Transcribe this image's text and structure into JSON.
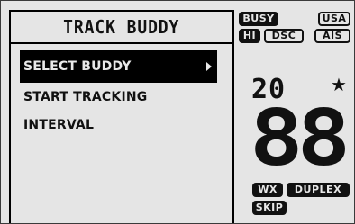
{
  "menu": {
    "title": "TRACK BUDDY",
    "items": [
      {
        "label": "SELECT BUDDY",
        "selected": true,
        "has_submenu": true
      },
      {
        "label": "START TRACKING",
        "selected": false,
        "has_submenu": false
      },
      {
        "label": "INTERVAL",
        "selected": false,
        "has_submenu": false
      }
    ]
  },
  "status": {
    "badges_top": [
      {
        "label": "BUSY",
        "style": "filled"
      },
      {
        "label": "USA",
        "style": "outline"
      },
      {
        "label": "HI",
        "style": "filled"
      },
      {
        "label": "DSC",
        "style": "outline"
      },
      {
        "label": "AIS",
        "style": "outline"
      }
    ],
    "channel": "20",
    "favorite_icon": "star-icon",
    "big_display": "88",
    "badges_bottom": [
      {
        "label": "WX",
        "style": "filled"
      },
      {
        "label": "DUPLEX",
        "style": "filled"
      },
      {
        "label": "SKIP",
        "style": "filled"
      }
    ]
  },
  "colors": {
    "lcd_background": "#e5e5e5",
    "foreground": "#111111",
    "inverse_text": "#e8e8e8"
  }
}
